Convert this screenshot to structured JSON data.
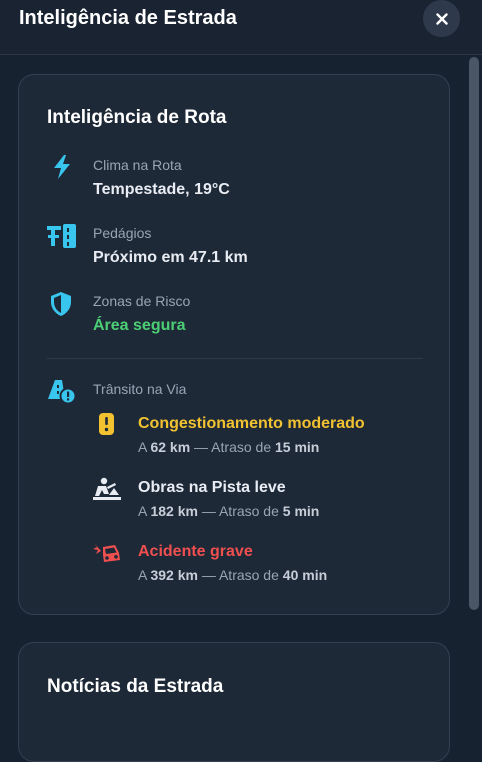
{
  "header": {
    "title": "Inteligência de Estrada",
    "close_label": "×"
  },
  "route_card": {
    "title": "Inteligência de Rota",
    "weather": {
      "label": "Clima na Rota",
      "value": "Tempestade, 19°C",
      "icon": "lightning-icon"
    },
    "tolls": {
      "label": "Pedágios",
      "value": "Próximo em 47.1 km",
      "icon": "toll-icon"
    },
    "risk": {
      "label": "Zonas de Risco",
      "value": "Área segura",
      "icon": "shield-icon"
    },
    "traffic": {
      "label": "Trânsito na Via",
      "icon": "traffic-alert-icon",
      "items": [
        {
          "title": "Congestionamento moderado",
          "prefix": "A ",
          "distance": "62 km",
          "middle": " — Atraso de ",
          "delay": "15 min",
          "color": "#f2c230",
          "icon": "traffic-light-icon"
        },
        {
          "title": "Obras na Pista leve",
          "prefix": "A ",
          "distance": "182 km",
          "middle": " — Atraso de ",
          "delay": "5 min",
          "color": "#e9edf3",
          "icon": "road-works-icon"
        },
        {
          "title": "Acidente grave",
          "prefix": "A ",
          "distance": "392 km",
          "middle": " — Atraso de ",
          "delay": "40 min",
          "color": "#ef4f4f",
          "icon": "car-crash-icon"
        }
      ]
    }
  },
  "news_card": {
    "title": "Notícias da Estrada"
  },
  "colors": {
    "accent_cyan": "#38c6ee",
    "safe_green": "#4ccf74",
    "warning_yellow": "#f2c230",
    "danger_red": "#ef4f4f"
  }
}
